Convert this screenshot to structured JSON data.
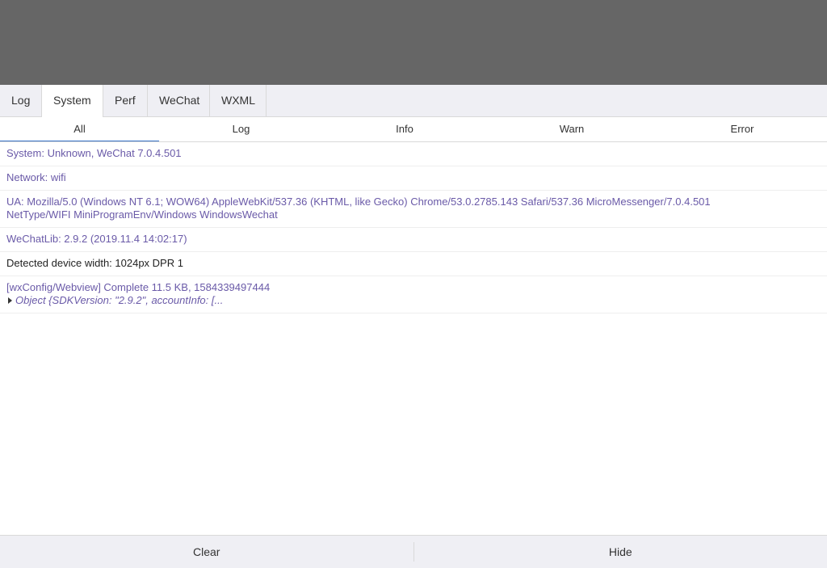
{
  "tabs": [
    {
      "label": "Log"
    },
    {
      "label": "System",
      "active": true
    },
    {
      "label": "Perf"
    },
    {
      "label": "WeChat"
    },
    {
      "label": "WXML"
    }
  ],
  "filters": [
    {
      "label": "All",
      "active": true
    },
    {
      "label": "Log"
    },
    {
      "label": "Info"
    },
    {
      "label": "Warn"
    },
    {
      "label": "Error"
    }
  ],
  "logs": {
    "system": "System: Unknown, WeChat 7.0.4.501",
    "network": "Network: wifi",
    "ua_line1": "UA: Mozilla/5.0 (Windows NT 6.1; WOW64) AppleWebKit/537.36 (KHTML, like Gecko) Chrome/53.0.2785.143 Safari/537.36 MicroMessenger/7.0.4.501",
    "ua_line2": "NetType/WIFI MiniProgramEnv/Windows WindowsWechat",
    "wechatlib": "WeChatLib: 2.9.2 (2019.11.4 14:02:17)",
    "device": "Detected device width: 1024px DPR 1",
    "wxconfig": "[wxConfig/Webview] Complete 11.5 KB, 1584339497444",
    "object_preview": "Object {SDKVersion: \"2.9.2\", accountInfo: [..."
  },
  "toolbar": {
    "clear_label": "Clear",
    "hide_label": "Hide"
  },
  "colors": {
    "info_text": "#6a5aa8",
    "active_tab_underline": "#3873c8",
    "mask": "#666666",
    "bar_background": "#efeff4"
  }
}
